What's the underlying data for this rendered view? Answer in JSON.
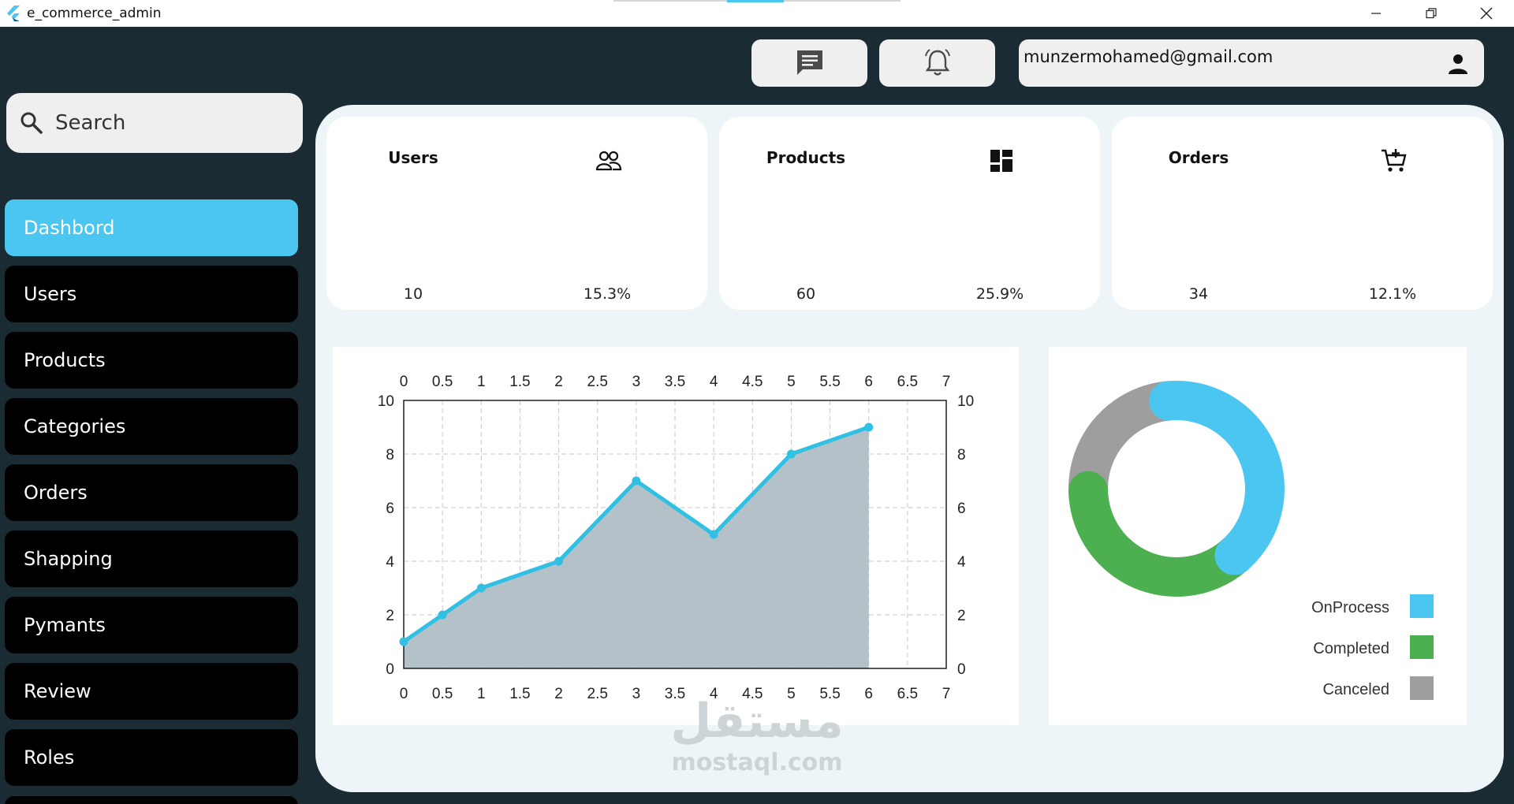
{
  "window": {
    "title": "e_commerce_admin"
  },
  "header": {
    "email": "munzermohamed@gmail.com"
  },
  "search": {
    "label": "Search"
  },
  "sidebar": {
    "items": [
      {
        "label": "Dashbord",
        "active": true
      },
      {
        "label": "Users"
      },
      {
        "label": "Products"
      },
      {
        "label": "Categories"
      },
      {
        "label": "Orders"
      },
      {
        "label": "Shapping"
      },
      {
        "label": "Pymants"
      },
      {
        "label": "Review"
      },
      {
        "label": "Roles"
      }
    ]
  },
  "stats": [
    {
      "title": "Users",
      "value": "10",
      "percent": "15.3%",
      "icon": "users-icon"
    },
    {
      "title": "Products",
      "value": "60",
      "percent": "25.9%",
      "icon": "dashboard-grid-icon"
    },
    {
      "title": "Orders",
      "value": "34",
      "percent": "12.1%",
      "icon": "cart-icon"
    }
  ],
  "colors": {
    "accent": "#4bc6f0",
    "completed": "#4caf50",
    "canceled": "#9e9e9e",
    "area": "#b0bec5",
    "line": "#2fc0e4"
  },
  "chart_data": [
    {
      "type": "area",
      "x": [
        0,
        0.5,
        1,
        2,
        3,
        4,
        5,
        6
      ],
      "y": [
        1,
        2,
        3,
        4,
        7,
        5,
        8,
        9
      ],
      "xlim": [
        0,
        7
      ],
      "ylim": [
        0,
        10
      ],
      "x_ticks": [
        "0",
        "0.5",
        "1",
        "1.5",
        "2",
        "2.5",
        "3",
        "3.5",
        "4",
        "4.5",
        "5",
        "5.5",
        "6",
        "6.5",
        "7"
      ],
      "y_ticks": [
        "0",
        "2",
        "4",
        "6",
        "8",
        "10"
      ],
      "grid": true
    },
    {
      "type": "pie",
      "donut": true,
      "labels": [
        "OnProcess",
        "Completed",
        "Canceled"
      ],
      "values": [
        40,
        36,
        24
      ],
      "legend": "bottom-right"
    }
  ],
  "watermark": {
    "arabic": "مستقل",
    "latin": "mostaql.com"
  }
}
